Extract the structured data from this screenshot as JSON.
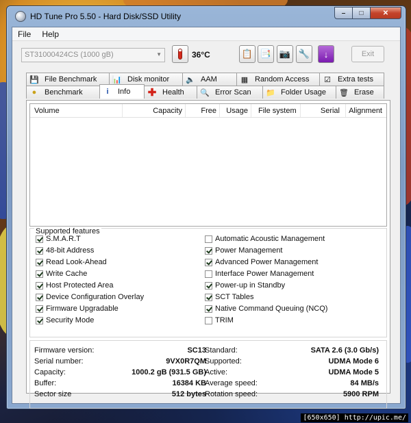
{
  "window": {
    "title": "HD Tune Pro 5.50 - Hard Disk/SSD Utility"
  },
  "menu": [
    "File",
    "Help"
  ],
  "toolbar": {
    "drive": "ST31000424CS (1000 gB)",
    "temperature": "36°C",
    "exit_label": "Exit"
  },
  "tabs_top": [
    "File Benchmark",
    "Disk monitor",
    "AAM",
    "Random Access",
    "Extra tests"
  ],
  "tabs_bottom": [
    "Benchmark",
    "Info",
    "Health",
    "Error Scan",
    "Folder Usage",
    "Erase"
  ],
  "active_tab": "Info",
  "volume_table": {
    "columns": [
      "Volume",
      "Capacity",
      "Free",
      "Usage",
      "File system",
      "Serial",
      "Alignment"
    ]
  },
  "features": {
    "legend": "Supported features",
    "left": [
      {
        "label": "S.M.A.R.T",
        "checked": true
      },
      {
        "label": "48-bit Address",
        "checked": true
      },
      {
        "label": "Read Look-Ahead",
        "checked": true
      },
      {
        "label": "Write Cache",
        "checked": true
      },
      {
        "label": "Host Protected Area",
        "checked": true
      },
      {
        "label": "Device Configuration Overlay",
        "checked": true
      },
      {
        "label": "Firmware Upgradable",
        "checked": true
      },
      {
        "label": "Security Mode",
        "checked": true
      }
    ],
    "right": [
      {
        "label": "Automatic Acoustic Management",
        "checked": false
      },
      {
        "label": "Power Management",
        "checked": true
      },
      {
        "label": "Advanced Power Management",
        "checked": true
      },
      {
        "label": "Interface Power Management",
        "checked": false
      },
      {
        "label": "Power-up in Standby",
        "checked": true
      },
      {
        "label": "SCT Tables",
        "checked": true
      },
      {
        "label": "Native Command Queuing (NCQ)",
        "checked": true
      },
      {
        "label": "TRIM",
        "checked": false
      }
    ]
  },
  "details": {
    "left": [
      {
        "label": "Firmware version:",
        "value": "SC13"
      },
      {
        "label": "Serial number:",
        "value": "9VX0R7QM"
      },
      {
        "label": "Capacity:",
        "value": "1000.2 gB (931.5 GB)"
      },
      {
        "label": "Buffer:",
        "value": "16384 KB"
      },
      {
        "label": "Sector size",
        "value": "512 bytes"
      }
    ],
    "right": [
      {
        "label": "Standard:",
        "value": "SATA 2.6 (3.0 Gb/s)"
      },
      {
        "label": "Supported:",
        "value": "UDMA Mode 6"
      },
      {
        "label": "Active:",
        "value": "UDMA Mode 5"
      },
      {
        "label": "Average speed:",
        "value": "84 MB/s"
      },
      {
        "label": "Rotation speed:",
        "value": "5900 RPM"
      }
    ]
  },
  "watermark": "[650x650] http://upic.me/"
}
